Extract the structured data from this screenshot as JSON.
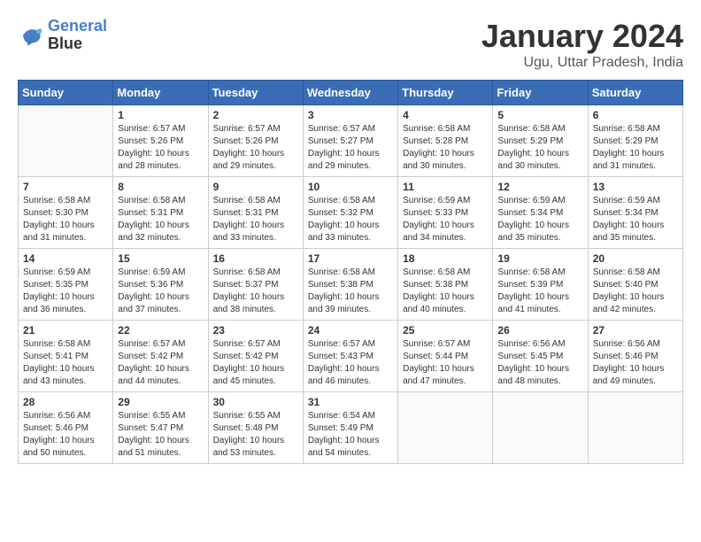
{
  "logo": {
    "line1": "General",
    "line2": "Blue"
  },
  "title": "January 2024",
  "subtitle": "Ugu, Uttar Pradesh, India",
  "days_header": [
    "Sunday",
    "Monday",
    "Tuesday",
    "Wednesday",
    "Thursday",
    "Friday",
    "Saturday"
  ],
  "weeks": [
    [
      {
        "num": "",
        "info": ""
      },
      {
        "num": "1",
        "info": "Sunrise: 6:57 AM\nSunset: 5:26 PM\nDaylight: 10 hours\nand 28 minutes."
      },
      {
        "num": "2",
        "info": "Sunrise: 6:57 AM\nSunset: 5:26 PM\nDaylight: 10 hours\nand 29 minutes."
      },
      {
        "num": "3",
        "info": "Sunrise: 6:57 AM\nSunset: 5:27 PM\nDaylight: 10 hours\nand 29 minutes."
      },
      {
        "num": "4",
        "info": "Sunrise: 6:58 AM\nSunset: 5:28 PM\nDaylight: 10 hours\nand 30 minutes."
      },
      {
        "num": "5",
        "info": "Sunrise: 6:58 AM\nSunset: 5:29 PM\nDaylight: 10 hours\nand 30 minutes."
      },
      {
        "num": "6",
        "info": "Sunrise: 6:58 AM\nSunset: 5:29 PM\nDaylight: 10 hours\nand 31 minutes."
      }
    ],
    [
      {
        "num": "7",
        "info": "Sunrise: 6:58 AM\nSunset: 5:30 PM\nDaylight: 10 hours\nand 31 minutes."
      },
      {
        "num": "8",
        "info": "Sunrise: 6:58 AM\nSunset: 5:31 PM\nDaylight: 10 hours\nand 32 minutes."
      },
      {
        "num": "9",
        "info": "Sunrise: 6:58 AM\nSunset: 5:31 PM\nDaylight: 10 hours\nand 33 minutes."
      },
      {
        "num": "10",
        "info": "Sunrise: 6:58 AM\nSunset: 5:32 PM\nDaylight: 10 hours\nand 33 minutes."
      },
      {
        "num": "11",
        "info": "Sunrise: 6:59 AM\nSunset: 5:33 PM\nDaylight: 10 hours\nand 34 minutes."
      },
      {
        "num": "12",
        "info": "Sunrise: 6:59 AM\nSunset: 5:34 PM\nDaylight: 10 hours\nand 35 minutes."
      },
      {
        "num": "13",
        "info": "Sunrise: 6:59 AM\nSunset: 5:34 PM\nDaylight: 10 hours\nand 35 minutes."
      }
    ],
    [
      {
        "num": "14",
        "info": "Sunrise: 6:59 AM\nSunset: 5:35 PM\nDaylight: 10 hours\nand 36 minutes."
      },
      {
        "num": "15",
        "info": "Sunrise: 6:59 AM\nSunset: 5:36 PM\nDaylight: 10 hours\nand 37 minutes."
      },
      {
        "num": "16",
        "info": "Sunrise: 6:58 AM\nSunset: 5:37 PM\nDaylight: 10 hours\nand 38 minutes."
      },
      {
        "num": "17",
        "info": "Sunrise: 6:58 AM\nSunset: 5:38 PM\nDaylight: 10 hours\nand 39 minutes."
      },
      {
        "num": "18",
        "info": "Sunrise: 6:58 AM\nSunset: 5:38 PM\nDaylight: 10 hours\nand 40 minutes."
      },
      {
        "num": "19",
        "info": "Sunrise: 6:58 AM\nSunset: 5:39 PM\nDaylight: 10 hours\nand 41 minutes."
      },
      {
        "num": "20",
        "info": "Sunrise: 6:58 AM\nSunset: 5:40 PM\nDaylight: 10 hours\nand 42 minutes."
      }
    ],
    [
      {
        "num": "21",
        "info": "Sunrise: 6:58 AM\nSunset: 5:41 PM\nDaylight: 10 hours\nand 43 minutes."
      },
      {
        "num": "22",
        "info": "Sunrise: 6:57 AM\nSunset: 5:42 PM\nDaylight: 10 hours\nand 44 minutes."
      },
      {
        "num": "23",
        "info": "Sunrise: 6:57 AM\nSunset: 5:42 PM\nDaylight: 10 hours\nand 45 minutes."
      },
      {
        "num": "24",
        "info": "Sunrise: 6:57 AM\nSunset: 5:43 PM\nDaylight: 10 hours\nand 46 minutes."
      },
      {
        "num": "25",
        "info": "Sunrise: 6:57 AM\nSunset: 5:44 PM\nDaylight: 10 hours\nand 47 minutes."
      },
      {
        "num": "26",
        "info": "Sunrise: 6:56 AM\nSunset: 5:45 PM\nDaylight: 10 hours\nand 48 minutes."
      },
      {
        "num": "27",
        "info": "Sunrise: 6:56 AM\nSunset: 5:46 PM\nDaylight: 10 hours\nand 49 minutes."
      }
    ],
    [
      {
        "num": "28",
        "info": "Sunrise: 6:56 AM\nSunset: 5:46 PM\nDaylight: 10 hours\nand 50 minutes."
      },
      {
        "num": "29",
        "info": "Sunrise: 6:55 AM\nSunset: 5:47 PM\nDaylight: 10 hours\nand 51 minutes."
      },
      {
        "num": "30",
        "info": "Sunrise: 6:55 AM\nSunset: 5:48 PM\nDaylight: 10 hours\nand 53 minutes."
      },
      {
        "num": "31",
        "info": "Sunrise: 6:54 AM\nSunset: 5:49 PM\nDaylight: 10 hours\nand 54 minutes."
      },
      {
        "num": "",
        "info": ""
      },
      {
        "num": "",
        "info": ""
      },
      {
        "num": "",
        "info": ""
      }
    ]
  ]
}
